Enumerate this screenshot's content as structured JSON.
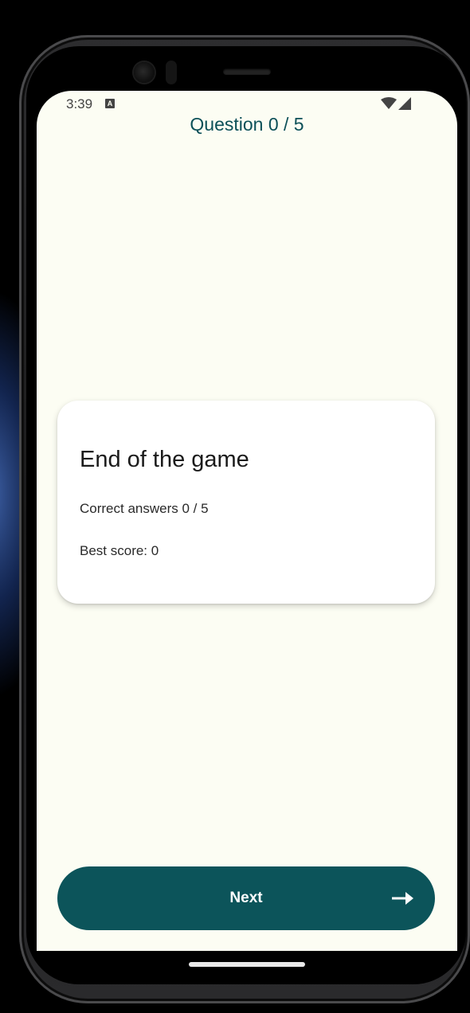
{
  "status_bar": {
    "time": "3:39",
    "notification_icon": "a-icon",
    "wifi_icon": "wifi-icon",
    "signal_icon": "signal-icon"
  },
  "header": {
    "question_counter": "Question 0 / 5"
  },
  "result_card": {
    "title": "End of the game",
    "correct_answers": "Correct answers 0 / 5",
    "best_score": "Best score: 0"
  },
  "next_button": {
    "label": "Next",
    "icon": "arrow-right-icon"
  },
  "colors": {
    "accent": "#0c545a",
    "background": "#fcfdf3",
    "card": "#ffffff",
    "title_text": "#0c5058"
  }
}
